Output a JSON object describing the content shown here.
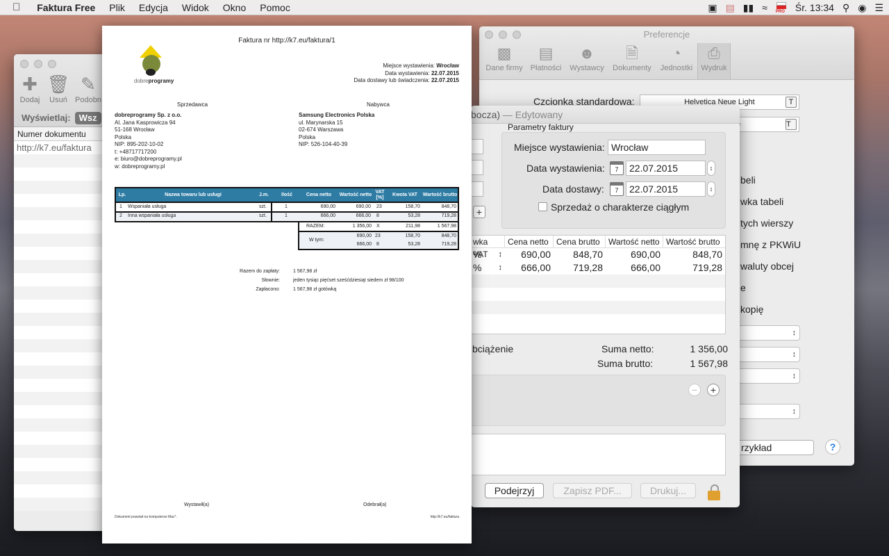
{
  "menubar": {
    "app": "Faktura Free",
    "items": [
      "Plik",
      "Edycja",
      "Widok",
      "Okno",
      "Pomoc"
    ],
    "clock": "Śr. 13:34",
    "flag_badge": "PRO"
  },
  "left_window": {
    "toolbar": [
      {
        "label": "Dodaj",
        "icon": "plus-doc-icon"
      },
      {
        "label": "Usuń",
        "icon": "trash-icon"
      },
      {
        "label": "Podobn",
        "icon": "copy-icon"
      }
    ],
    "filter_label": "Wyświetlaj:",
    "filter_value": "Wsz",
    "column": "Numer dokumentu",
    "rows": [
      "http://k7.eu/faktura"
    ]
  },
  "prefs": {
    "title": "Preferencje",
    "tabs": [
      "Dane firmy",
      "Płatności",
      "Wystawcy",
      "Dokumenty",
      "Jednostki",
      "Wydruk"
    ],
    "font_label": "Czcionka standardowa:",
    "font_value": "Helvetica Neue Light",
    "font_value2": "e",
    "options": [
      "beli",
      "wka tabeli",
      "tych wierszy",
      "mnę z PKWiU",
      "waluty obcej",
      "e",
      "kopię"
    ],
    "example_button": "rzykład"
  },
  "editor": {
    "title_tail": "bocza)",
    "edited": "— Edytowany",
    "group_title": "Parametry faktury",
    "place_label": "Miejsce wystawienia:",
    "place_value": "Wrocław",
    "issue_label": "Data wystawienia:",
    "issue_value": "22.07.2015",
    "delivery_label": "Data dostawy:",
    "delivery_value": "22.07.2015",
    "cal_day": "7",
    "continuous_label": "Sprzedaż o charakterze ciągłym",
    "table_headers": [
      "wka VAT",
      "Cena netto",
      "Cena brutto",
      "Wartość netto",
      "Wartość brutto"
    ],
    "rows": [
      {
        "vat": "%",
        "net": "690,00",
        "gross": "848,70",
        "vnet": "690,00",
        "vgross": "848,70"
      },
      {
        "vat": "%",
        "net": "666,00",
        "gross": "719,28",
        "vnet": "666,00",
        "vgross": "719,28"
      }
    ],
    "obciazenie": "bciążenie",
    "sum_net_label": "Suma netto:",
    "sum_net": "1 356,00",
    "sum_gross_label": "Suma brutto:",
    "sum_gross": "1 567,98",
    "btn_preview": "Podejrzyj",
    "btn_pdf": "Zapisz  PDF...",
    "btn_print": "Drukuj..."
  },
  "invoice": {
    "title": "Faktura nr http://k7.eu/faktura/1",
    "logo_a": "dobre",
    "logo_b": "programy",
    "place_line_label": "Miejsce wystawienia:",
    "place_line_value": "Wrocław",
    "issue_line_label": "Data wystawienia:",
    "issue_line_value": "22.07.2015",
    "delivery_line_label": "Data dostawy lub świadczenia:",
    "delivery_line_value": "22.07.2015",
    "seller_h": "Sprzedawca",
    "buyer_h": "Nabywca",
    "seller": {
      "name": "dobreprogramy Sp. z o.o.",
      "lines": [
        "Al. Jana Kasprowicza 94",
        "51-168 Wrocław",
        "Polska",
        "NIP: 895-202-10-02",
        "t: +48717717200",
        "e: biuro@dobreprogramy.pl",
        "w: dobreprogramy.pl"
      ]
    },
    "buyer": {
      "name": "Samsung Electronics Polska",
      "lines": [
        "ul. Marynarska 15",
        "02-674 Warszawa",
        "Polska",
        "NIP: 526-104-40-39"
      ]
    },
    "headers": [
      "Lp.",
      "Nazwa towaru lub usługi",
      "J.m.",
      "Ilość",
      "Cena netto",
      "Wartość netto",
      "VAT [%]",
      "Kwota VAT",
      "Wartość brutto"
    ],
    "items": [
      [
        "1",
        "Wspaniała usługa",
        "szt.",
        "1",
        "690,00",
        "690,00",
        "23",
        "158,70",
        "848,70"
      ],
      [
        "2",
        "Inna wspaniała usługa",
        "szt.",
        "1",
        "666,00",
        "666,00",
        "8",
        "53,28",
        "719,28"
      ]
    ],
    "total": {
      "label": "RAZEM:",
      "net": "1 356,00",
      "vat": "X",
      "vat_amount": "211,98",
      "gross": "1 567,98"
    },
    "breakdown_label": "W tym:",
    "breakdown": [
      [
        "690,00",
        "23",
        "158,70",
        "848,70"
      ],
      [
        "666,00",
        "8",
        "53,28",
        "719,28"
      ]
    ],
    "to_pay_label": "Razem do zapłaty:",
    "to_pay": "1 567,98 zł",
    "words_label": "Słownie:",
    "words": "jeden tysiąc pięćset sześćdziesiąt siedem zł 98/100",
    "paid_label": "Zapłacono:",
    "paid": "1 567,98 zł gotówką",
    "issued_by": "Wystawił(a)",
    "received_by": "Odebrał(a)",
    "footer_left": "Dokument powstał na komputerze Mac*.",
    "footer_right": "http://k7.eu/faktura"
  }
}
